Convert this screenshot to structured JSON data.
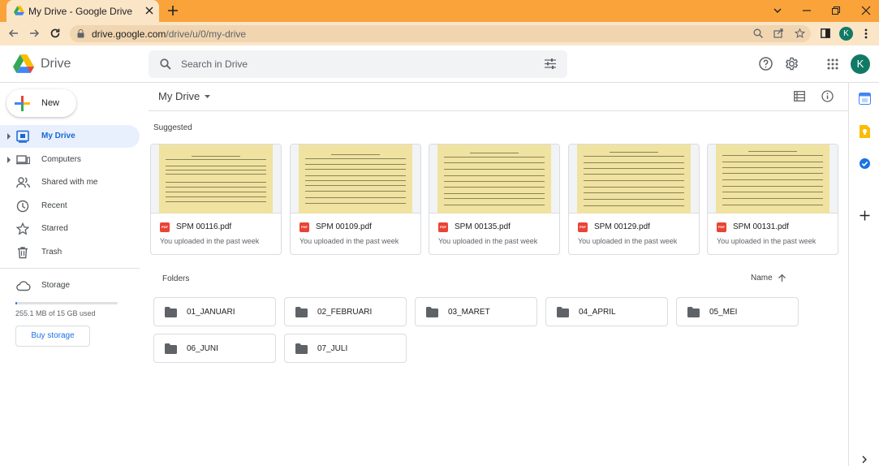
{
  "browser": {
    "tab_title": "My Drive - Google Drive",
    "url_host": "drive.google.com",
    "url_path": "/drive/u/0/my-drive",
    "avatar_letter": "K"
  },
  "header": {
    "app_name": "Drive",
    "search_placeholder": "Search in Drive",
    "avatar_letter": "K"
  },
  "sidebar": {
    "new_label": "New",
    "items": [
      {
        "label": "My Drive",
        "icon": "my-drive-icon",
        "active": true
      },
      {
        "label": "Computers",
        "icon": "computers-icon",
        "active": false
      },
      {
        "label": "Shared with me",
        "icon": "shared-icon",
        "active": false
      },
      {
        "label": "Recent",
        "icon": "clock-icon",
        "active": false
      },
      {
        "label": "Starred",
        "icon": "star-icon",
        "active": false
      },
      {
        "label": "Trash",
        "icon": "trash-icon",
        "active": false
      }
    ],
    "storage_label": "Storage",
    "storage_used_text": "255.1 MB of 15 GB used",
    "storage_fraction": 0.017,
    "buy_storage_label": "Buy storage"
  },
  "main": {
    "title": "My Drive",
    "suggested_label": "Suggested",
    "suggested": [
      {
        "name": "SPM 00116.pdf",
        "subtitle": "You uploaded in the past week"
      },
      {
        "name": "SPM 00109.pdf",
        "subtitle": "You uploaded in the past week"
      },
      {
        "name": "SPM 00135.pdf",
        "subtitle": "You uploaded in the past week"
      },
      {
        "name": "SPM 00129.pdf",
        "subtitle": "You uploaded in the past week"
      },
      {
        "name": "SPM 00131.pdf",
        "subtitle": "You uploaded in the past week"
      }
    ],
    "pdf_badge": "PDF",
    "folders_label": "Folders",
    "sort_label": "Name",
    "folders": [
      {
        "name": "01_JANUARI"
      },
      {
        "name": "02_FEBRUARI"
      },
      {
        "name": "03_MARET"
      },
      {
        "name": "04_APRIL"
      },
      {
        "name": "05_MEI"
      },
      {
        "name": "06_JUNI"
      },
      {
        "name": "07_JULI"
      }
    ]
  },
  "colors": {
    "tab_bar": "#f9a33a",
    "active_nav": "#e8f0fe",
    "accent": "#1a73e8",
    "avatar": "#117a65"
  }
}
